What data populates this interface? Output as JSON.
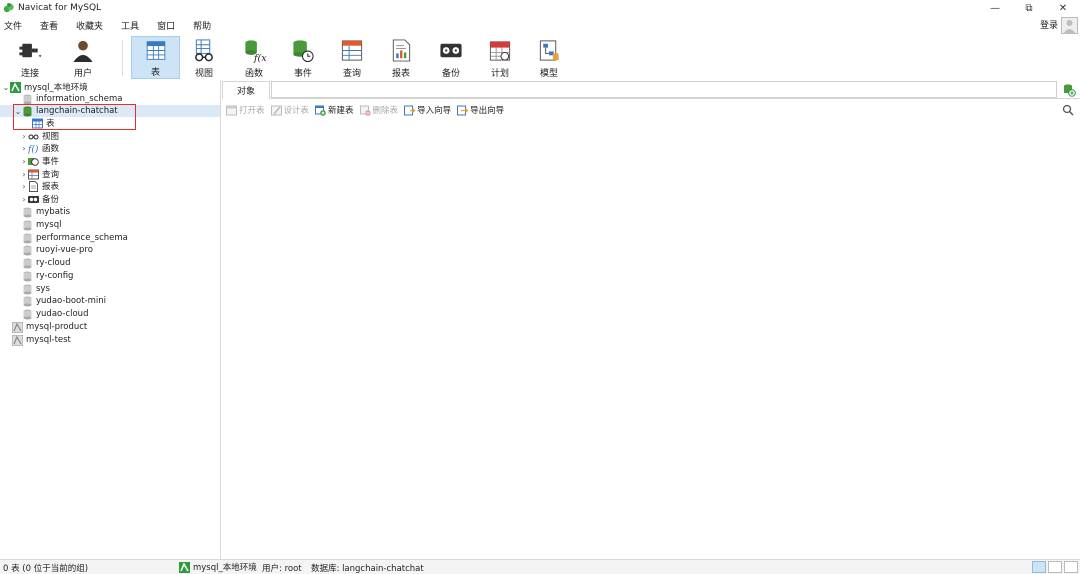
{
  "window": {
    "title": "Navicat for MySQL",
    "minimize": "—",
    "restore": "⧉",
    "close": "✕"
  },
  "menu": [
    "文件",
    "查看",
    "收藏夹",
    "工具",
    "窗口",
    "帮助"
  ],
  "account": {
    "login": "登录"
  },
  "toolbar": [
    {
      "label": "连接",
      "icon": "plug-icon"
    },
    {
      "label": "用户",
      "icon": "user-icon"
    },
    {
      "label": "表",
      "icon": "table-icon",
      "active": true
    },
    {
      "label": "视图",
      "icon": "view-icon"
    },
    {
      "label": "函数",
      "icon": "function-icon"
    },
    {
      "label": "事件",
      "icon": "event-icon"
    },
    {
      "label": "查询",
      "icon": "query-icon"
    },
    {
      "label": "报表",
      "icon": "report-icon"
    },
    {
      "label": "备份",
      "icon": "backup-icon"
    },
    {
      "label": "计划",
      "icon": "schedule-icon"
    },
    {
      "label": "模型",
      "icon": "model-icon"
    }
  ],
  "tree": {
    "connection": "mysql_本地环境",
    "databases": [
      "information_schema",
      "langchain-chatchat",
      "mybatis",
      "mysql",
      "performance_schema",
      "ruoyi-vue-pro",
      "ry-cloud",
      "ry-config",
      "sys",
      "yudao-boot-mini",
      "yudao-cloud"
    ],
    "children": [
      "表",
      "视图",
      "函数",
      "事件",
      "查询",
      "报表",
      "备份"
    ],
    "other_connections": [
      "mysql-product",
      "mysql-test"
    ]
  },
  "main": {
    "tab": "对象",
    "actions": [
      {
        "label": "打开表",
        "enabled": false
      },
      {
        "label": "设计表",
        "enabled": false
      },
      {
        "label": "新建表",
        "enabled": true
      },
      {
        "label": "删除表",
        "enabled": false
      },
      {
        "label": "导入向导",
        "enabled": true
      },
      {
        "label": "导出向导",
        "enabled": true
      }
    ]
  },
  "status": {
    "count": "0 表 (0 位于当前的组)",
    "connection": "mysql_本地环境",
    "user": "用户: root",
    "database": "数据库: langchain-chatchat"
  },
  "colors": {
    "accent": "#cde4f7",
    "highlight_box": "#e0302e",
    "navicat_green": "#2e9b3f"
  }
}
